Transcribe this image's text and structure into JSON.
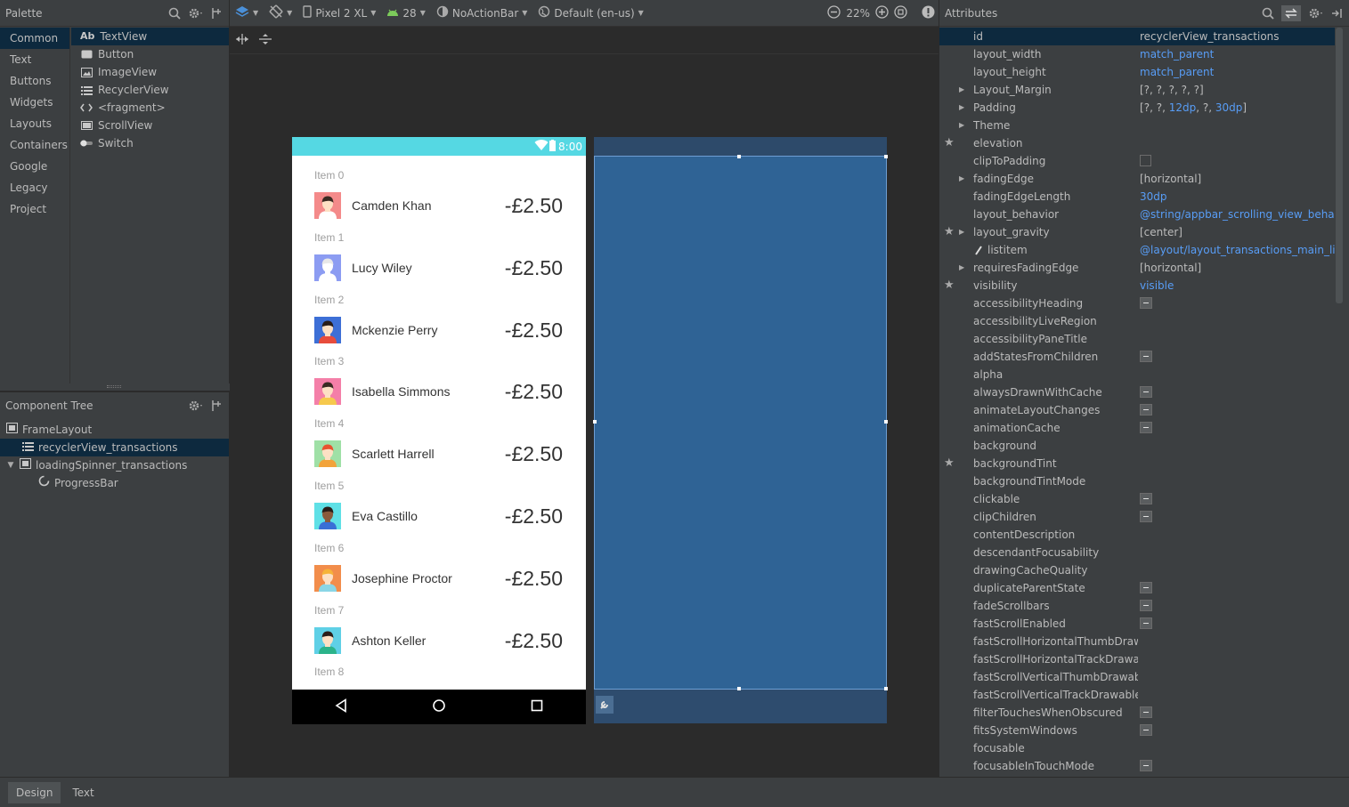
{
  "palette": {
    "title": "Palette",
    "categories": [
      "Common",
      "Text",
      "Buttons",
      "Widgets",
      "Layouts",
      "Containers",
      "Google",
      "Legacy",
      "Project"
    ],
    "items": [
      {
        "label": "TextView",
        "icon": "Ab"
      },
      {
        "label": "Button",
        "icon": "button-icon"
      },
      {
        "label": "ImageView",
        "icon": "image-icon"
      },
      {
        "label": "RecyclerView",
        "icon": "list-icon"
      },
      {
        "label": "<fragment>",
        "icon": "code-icon"
      },
      {
        "label": "ScrollView",
        "icon": "scroll-icon"
      },
      {
        "label": "Switch",
        "icon": "switch-icon"
      }
    ]
  },
  "component_tree": {
    "title": "Component Tree",
    "nodes": [
      "FrameLayout",
      "recyclerView_transactions",
      "loadingSpinner_transactions",
      "ProgressBar"
    ]
  },
  "toolbar": {
    "device": "Pixel 2 XL",
    "api": "28",
    "theme": "NoActionBar",
    "locale": "Default (en-us)",
    "zoom": "22%"
  },
  "phone": {
    "time": "8:00",
    "items": [
      {
        "header": "Item 0",
        "name": "Camden Khan",
        "amount": "-£2.50",
        "bg": "#f48a8a",
        "skin": "#fde0c4",
        "hair": "#3a2a22",
        "shirt": "#ffffff"
      },
      {
        "header": "Item 1",
        "name": "Lucy Wiley",
        "amount": "-£2.50",
        "bg": "#8c9cf2",
        "skin": "#ffffff",
        "hair": "#e8e8e8",
        "shirt": "#ffffff"
      },
      {
        "header": "Item 2",
        "name": "Mckenzie Perry",
        "amount": "-£2.50",
        "bg": "#3d6fd6",
        "skin": "#fde0c4",
        "hair": "#2a1d18",
        "shirt": "#e74c3c"
      },
      {
        "header": "Item 3",
        "name": "Isabella Simmons",
        "amount": "-£2.50",
        "bg": "#f47fa8",
        "skin": "#fde0c4",
        "hair": "#3a2a22",
        "shirt": "#f6c94d"
      },
      {
        "header": "Item 4",
        "name": "Scarlett Harrell",
        "amount": "-£2.50",
        "bg": "#9fe0a6",
        "skin": "#fde0c4",
        "hair": "#e8532f",
        "shirt": "#f2a33a"
      },
      {
        "header": "Item 5",
        "name": "Eva Castillo",
        "amount": "-£2.50",
        "bg": "#5fe0e6",
        "skin": "#8a5a3c",
        "hair": "#2a1d18",
        "shirt": "#3a6fd6"
      },
      {
        "header": "Item 6",
        "name": "Josephine Proctor",
        "amount": "-£2.50",
        "bg": "#f28d4b",
        "skin": "#fde0c4",
        "hair": "#f6b33a",
        "shirt": "#8ad6e6"
      },
      {
        "header": "Item 7",
        "name": "Ashton Keller",
        "amount": "-£2.50",
        "bg": "#5fd0e6",
        "skin": "#fde0c4",
        "hair": "#2a1d18",
        "shirt": "#2bb38a"
      },
      {
        "header": "Item 8"
      }
    ]
  },
  "attributes": {
    "title": "Attributes",
    "rows": [
      {
        "name": "id",
        "value": "recyclerView_transactions",
        "selected": true
      },
      {
        "name": "layout_width",
        "value": "match_parent",
        "link": true
      },
      {
        "name": "layout_height",
        "value": "match_parent",
        "link": true
      },
      {
        "name": "Layout_Margin",
        "value": "[?, ?, ?, ?, ?]",
        "expand": true
      },
      {
        "name": "Padding",
        "value": "[?, ?, 12dp, ?, 30dp]",
        "expand": true,
        "padding": true
      },
      {
        "name": "Theme",
        "value": "",
        "expand": true
      },
      {
        "name": "elevation",
        "value": "",
        "star": true
      },
      {
        "name": "clipToPadding",
        "value": "",
        "checkbox": true
      },
      {
        "name": "fadingEdge",
        "value": "[horizontal]",
        "expand": true
      },
      {
        "name": "fadingEdgeLength",
        "value": "30dp",
        "link": true
      },
      {
        "name": "layout_behavior",
        "value": "@string/appbar_scrolling_view_behavior",
        "link": true
      },
      {
        "name": "layout_gravity",
        "value": "[center]",
        "star": true,
        "expand": true
      },
      {
        "name": "listitem",
        "value": "@layout/layout_transactions_main_list_item",
        "link": true,
        "brush": true
      },
      {
        "name": "requiresFadingEdge",
        "value": "[horizontal]",
        "expand": true
      },
      {
        "name": "visibility",
        "value": "visible",
        "link": true,
        "star": true
      },
      {
        "name": "accessibilityHeading",
        "value": "",
        "minus": true
      },
      {
        "name": "accessibilityLiveRegion",
        "value": ""
      },
      {
        "name": "accessibilityPaneTitle",
        "value": ""
      },
      {
        "name": "addStatesFromChildren",
        "value": "",
        "minus": true
      },
      {
        "name": "alpha",
        "value": ""
      },
      {
        "name": "alwaysDrawnWithCache",
        "value": "",
        "minus": true
      },
      {
        "name": "animateLayoutChanges",
        "value": "",
        "minus": true
      },
      {
        "name": "animationCache",
        "value": "",
        "minus": true
      },
      {
        "name": "background",
        "value": ""
      },
      {
        "name": "backgroundTint",
        "value": "",
        "star": true
      },
      {
        "name": "backgroundTintMode",
        "value": ""
      },
      {
        "name": "clickable",
        "value": "",
        "minus": true
      },
      {
        "name": "clipChildren",
        "value": "",
        "minus": true
      },
      {
        "name": "contentDescription",
        "value": ""
      },
      {
        "name": "descendantFocusability",
        "value": ""
      },
      {
        "name": "drawingCacheQuality",
        "value": ""
      },
      {
        "name": "duplicateParentState",
        "value": "",
        "minus": true
      },
      {
        "name": "fadeScrollbars",
        "value": "",
        "minus": true
      },
      {
        "name": "fastScrollEnabled",
        "value": "",
        "minus": true
      },
      {
        "name": "fastScrollHorizontalThumbDrawable",
        "value": ""
      },
      {
        "name": "fastScrollHorizontalTrackDrawable",
        "value": ""
      },
      {
        "name": "fastScrollVerticalThumbDrawable",
        "value": ""
      },
      {
        "name": "fastScrollVerticalTrackDrawable",
        "value": ""
      },
      {
        "name": "filterTouchesWhenObscured",
        "value": "",
        "minus": true
      },
      {
        "name": "fitsSystemWindows",
        "value": "",
        "minus": true
      },
      {
        "name": "focusable",
        "value": ""
      },
      {
        "name": "focusableInTouchMode",
        "value": "",
        "minus": true
      }
    ]
  },
  "bottom_tabs": [
    "Design",
    "Text"
  ],
  "colors": {
    "panel": "#3c3f41",
    "selection": "#0d293e",
    "link": "#589df6",
    "status_bar": "#55d8e3",
    "blueprint": "#2f6395"
  }
}
